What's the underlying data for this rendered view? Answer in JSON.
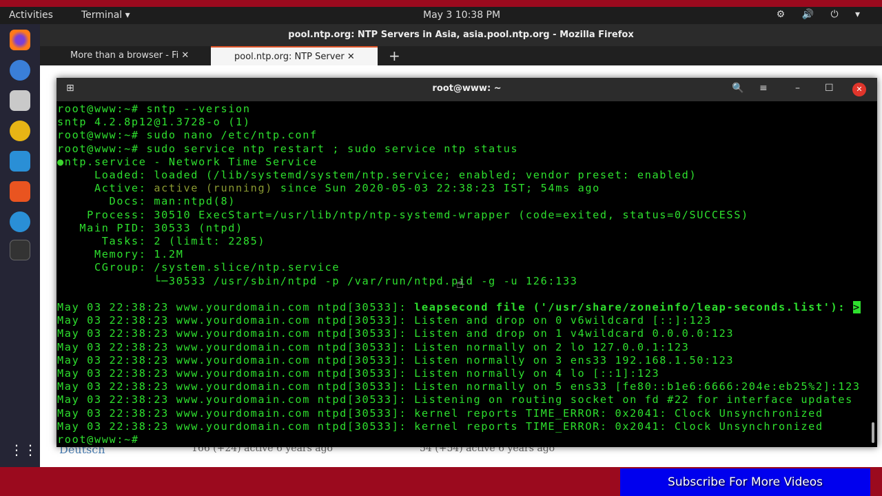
{
  "topbar": {
    "activities": "Activities",
    "app_menu": "Terminal ▾",
    "clock": "May 3  10:38 PM",
    "tray": "⚙ 🔊 ⏻ ▾"
  },
  "firefox": {
    "title": "pool.ntp.org: NTP Servers in Asia, asia.pool.ntp.org - Mozilla Firefox",
    "tabs": [
      {
        "label": "More than a browser - Fi",
        "close": "✕"
      },
      {
        "label": "pool.ntp.org: NTP Server",
        "close": "✕"
      }
    ],
    "new_tab": "+",
    "page": {
      "language_link": "Deutsch",
      "stat1": "166 (+24) active 6 years ago",
      "stat2": "54 (+54) active 6 years ago"
    }
  },
  "terminal": {
    "title": "root@www: ~",
    "search": "🔍",
    "menu": "≡",
    "minimize": "–",
    "maximize": "☐",
    "close": "✕",
    "lines": [
      [
        {
          "t": "root@www:~# sntp --version"
        }
      ],
      [
        {
          "t": "sntp 4.2.8p12@1.3728-o (1)"
        }
      ],
      [
        {
          "t": "root@www:~# sudo nano /etc/ntp.conf"
        }
      ],
      [
        {
          "t": "root@www:~# sudo service ntp restart ; sudo service ntp status"
        }
      ],
      [
        {
          "t": "●",
          "c": "dot"
        },
        {
          "t": "ntp.service - Network Time Service"
        }
      ],
      [
        {
          "t": "     Loaded: loaded (/lib/systemd/system/ntp.service; enabled; vendor preset: enabled)"
        }
      ],
      [
        {
          "t": "     Active: "
        },
        {
          "t": "active (running)",
          "c": "olive"
        },
        {
          "t": " since Sun 2020-05-03 22:38:23 IST; 54ms ago"
        }
      ],
      [
        {
          "t": "       Docs: man:ntpd(8)"
        }
      ],
      [
        {
          "t": "    Process: 30510 ExecStart=/usr/lib/ntp/ntp-systemd-wrapper (code=exited, status=0/SUCCESS)"
        }
      ],
      [
        {
          "t": "   Main PID: 30533 (ntpd)"
        }
      ],
      [
        {
          "t": "      Tasks: 2 (limit: 2285)"
        }
      ],
      [
        {
          "t": "     Memory: 1.2M"
        }
      ],
      [
        {
          "t": "     CGroup: /system.slice/ntp.service"
        }
      ],
      [
        {
          "t": "             └─30533 /usr/sbin/ntpd -p /var/run/ntpd.pid -g -u 126:133"
        }
      ],
      [
        {
          "t": " "
        }
      ],
      [
        {
          "t": "May 03 22:38:23 www.yourdomain.com ntpd[30533]: "
        },
        {
          "t": "leapsecond file ('/usr/share/zoneinfo/leap-seconds.list'): ",
          "c": "b"
        },
        {
          "t": ">",
          "c": "cursor"
        }
      ],
      [
        {
          "t": "May 03 22:38:23 www.yourdomain.com ntpd[30533]: Listen and drop on 0 v6wildcard [::]:123"
        }
      ],
      [
        {
          "t": "May 03 22:38:23 www.yourdomain.com ntpd[30533]: Listen and drop on 1 v4wildcard 0.0.0.0:123"
        }
      ],
      [
        {
          "t": "May 03 22:38:23 www.yourdomain.com ntpd[30533]: Listen normally on 2 lo 127.0.0.1:123"
        }
      ],
      [
        {
          "t": "May 03 22:38:23 www.yourdomain.com ntpd[30533]: Listen normally on 3 ens33 192.168.1.50:123"
        }
      ],
      [
        {
          "t": "May 03 22:38:23 www.yourdomain.com ntpd[30533]: Listen normally on 4 lo [::1]:123"
        }
      ],
      [
        {
          "t": "May 03 22:38:23 www.yourdomain.com ntpd[30533]: Listen normally on 5 ens33 [fe80::b1e6:6666:204e:eb25%2]:123"
        }
      ],
      [
        {
          "t": "May 03 22:38:23 www.yourdomain.com ntpd[30533]: Listening on routing socket on fd #22 for interface updates"
        }
      ],
      [
        {
          "t": "May 03 22:38:23 www.yourdomain.com ntpd[30533]: kernel reports TIME_ERROR: 0x2041: Clock Unsynchronized"
        }
      ],
      [
        {
          "t": "May 03 22:38:23 www.yourdomain.com ntpd[30533]: kernel reports TIME_ERROR: 0x2041: Clock Unsynchronized"
        }
      ],
      [
        {
          "t": "root@www:~# "
        }
      ]
    ]
  },
  "overlay": {
    "subscribe": "Subscribe For More Videos"
  },
  "colors": {
    "terminal_text": "#2ee02e",
    "banner": "#9b0a1e",
    "subscribe_bg": "#0000ee"
  }
}
